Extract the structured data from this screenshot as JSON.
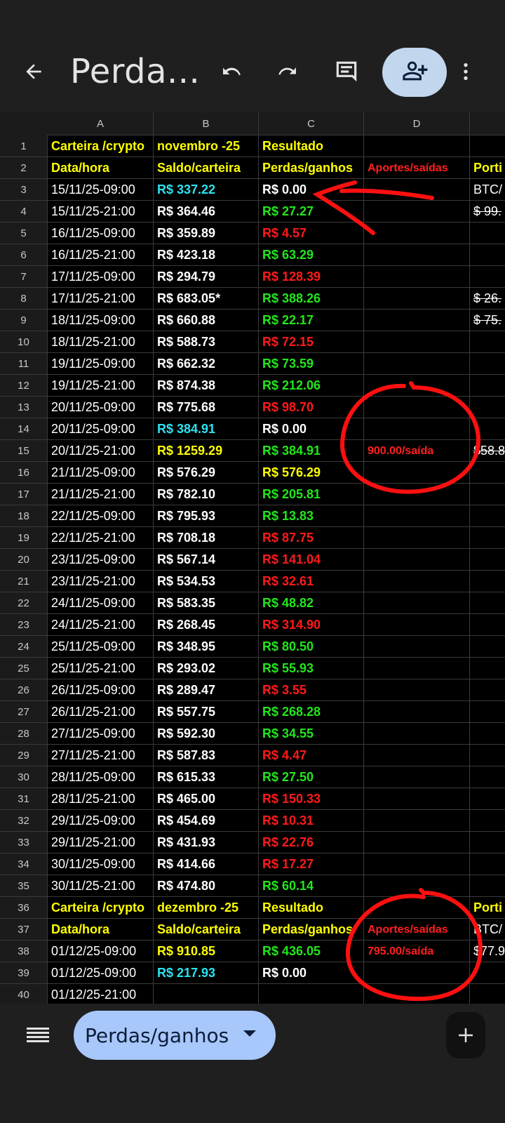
{
  "toolbar": {
    "title": "Perda...",
    "icons": [
      "back-arrow-icon",
      "undo-icon",
      "redo-icon",
      "comment-icon",
      "add-person-icon",
      "more-vert-icon"
    ]
  },
  "columns": [
    "A",
    "B",
    "C",
    "D"
  ],
  "rows": [
    {
      "n": "1",
      "a": "Carteira /crypto",
      "b": "  novembro -25",
      "c": "Resultado",
      "d": "",
      "e": "",
      "style": "header"
    },
    {
      "n": "2",
      "a": "Data/hora",
      "b": "Saldo/carteira",
      "c": "Perdas/ganhos",
      "d": "Aportes/saídas",
      "e": "Porti",
      "style": "header"
    },
    {
      "n": "3",
      "a": "15/11/25-09:00",
      "b": "R$ 337.22",
      "bc": "cyan",
      "c": "R$ 0.00",
      "cc": "white",
      "d": "",
      "e": "BTC/"
    },
    {
      "n": "4",
      "a": "15/11/25-21:00",
      "b": "R$ 364.46",
      "bc": "white",
      "c": "R$ 27.27",
      "cc": "green",
      "d": "",
      "e": "$ 99.",
      "es": "strike"
    },
    {
      "n": "5",
      "a": "16/11/25-09:00",
      "b": "R$ 359.89",
      "bc": "white",
      "c": "R$ 4.57",
      "cc": "red",
      "d": "",
      "e": ""
    },
    {
      "n": "6",
      "a": "16/11/25-21:00",
      "b": "R$ 423.18",
      "bc": "white",
      "c": "R$ 63.29",
      "cc": "green",
      "d": "",
      "e": ""
    },
    {
      "n": "7",
      "a": "17/11/25-09:00",
      "b": "R$ 294.79",
      "bc": "white",
      "c": "R$ 128.39",
      "cc": "red",
      "d": "",
      "e": ""
    },
    {
      "n": "8",
      "a": "17/11/25-21:00",
      "b": "R$ 683.05*",
      "bc": "white",
      "c": "R$ 388.26",
      "cc": "green",
      "d": "",
      "e": "$ 26.",
      "es": "strike"
    },
    {
      "n": "9",
      "a": "18/11/25-09:00",
      "b": "R$ 660.88",
      "bc": "white",
      "c": "R$ 22.17",
      "cc": "green",
      "d": "",
      "e": "$ 75.",
      "es": "strike"
    },
    {
      "n": "10",
      "a": "18/11/25-21:00",
      "b": "R$ 588.73",
      "bc": "white",
      "c": "R$ 72.15",
      "cc": "red",
      "d": "",
      "e": ""
    },
    {
      "n": "11",
      "a": "19/11/25-09:00",
      "b": "R$ 662.32",
      "bc": "white",
      "c": "R$ 73.59",
      "cc": "green",
      "d": "",
      "e": ""
    },
    {
      "n": "12",
      "a": "19/11/25-21:00",
      "b": "R$ 874.38",
      "bc": "white",
      "c": "R$ 212.06",
      "cc": "green",
      "d": "",
      "e": ""
    },
    {
      "n": "13",
      "a": "20/11/25-09:00",
      "b": "R$ 775.68",
      "bc": "white",
      "c": "R$ 98.70",
      "cc": "red",
      "d": "",
      "e": ""
    },
    {
      "n": "14",
      "a": "20/11/25-09:00",
      "b": "R$ 384.91",
      "bc": "cyan",
      "c": "R$ 0.00",
      "cc": "white",
      "d": "",
      "e": ""
    },
    {
      "n": "15",
      "a": "20/11/25-21:00",
      "b": "R$ 1259.29",
      "bc": "yellow",
      "c": "R$ 384.91",
      "cc": "green",
      "d": "900.00/saída",
      "e": "$58.8",
      "es": "strike"
    },
    {
      "n": "16",
      "a": "21/11/25-09:00",
      "b": "R$ 576.29",
      "bc": "white",
      "c": "R$ 576.29",
      "cc": "yellow",
      "d": "",
      "e": ""
    },
    {
      "n": "17",
      "a": "21/11/25-21:00",
      "b": "R$ 782.10",
      "bc": "white",
      "c": "R$ 205.81",
      "cc": "green",
      "d": "",
      "e": ""
    },
    {
      "n": "18",
      "a": "22/11/25-09:00",
      "b": "R$ 795.93",
      "bc": "white",
      "c": "R$ 13.83",
      "cc": "green",
      "d": "",
      "e": ""
    },
    {
      "n": "19",
      "a": "22/11/25-21:00",
      "b": "R$ 708.18",
      "bc": "white",
      "c": "R$ 87.75",
      "cc": "red",
      "d": "",
      "e": ""
    },
    {
      "n": "20",
      "a": "23/11/25-09:00",
      "b": "R$ 567.14",
      "bc": "white",
      "c": "R$ 141.04",
      "cc": "red",
      "d": "",
      "e": ""
    },
    {
      "n": "21",
      "a": "23/11/25-21:00",
      "b": "R$ 534.53",
      "bc": "white",
      "c": "R$ 32.61",
      "cc": "red",
      "d": "",
      "e": ""
    },
    {
      "n": "22",
      "a": "24/11/25-09:00",
      "b": "R$ 583.35",
      "bc": "white",
      "c": "R$ 48.82",
      "cc": "green",
      "d": "",
      "e": ""
    },
    {
      "n": "23",
      "a": "24/11/25-21:00",
      "b": "R$ 268.45",
      "bc": "white",
      "c": "R$ 314.90",
      "cc": "red",
      "d": "",
      "e": ""
    },
    {
      "n": "24",
      "a": "25/11/25-09:00",
      "b": "R$ 348.95",
      "bc": "white",
      "c": "R$ 80.50",
      "cc": "green",
      "d": "",
      "e": ""
    },
    {
      "n": "25",
      "a": "25/11/25-21:00",
      "b": "R$ 293.02",
      "bc": "white",
      "c": "R$ 55.93",
      "cc": "green",
      "d": "",
      "e": ""
    },
    {
      "n": "26",
      "a": "26/11/25-09:00",
      "b": "R$ 289.47",
      "bc": "white",
      "c": "R$ 3.55",
      "cc": "red",
      "d": "",
      "e": ""
    },
    {
      "n": "27",
      "a": "26/11/25-21:00",
      "b": "R$ 557.75",
      "bc": "white",
      "c": "R$ 268.28",
      "cc": "green",
      "d": "",
      "e": ""
    },
    {
      "n": "28",
      "a": "27/11/25-09:00",
      "b": "R$ 592.30",
      "bc": "white",
      "c": "R$ 34.55",
      "cc": "green",
      "d": "",
      "e": ""
    },
    {
      "n": "29",
      "a": "27/11/25-21:00",
      "b": "R$ 587.83",
      "bc": "white",
      "c": "R$ 4.47",
      "cc": "red",
      "d": "",
      "e": ""
    },
    {
      "n": "30",
      "a": "28/11/25-09:00",
      "b": "R$ 615.33",
      "bc": "white",
      "c": "R$ 27.50",
      "cc": "green",
      "d": "",
      "e": ""
    },
    {
      "n": "31",
      "a": "28/11/25-21:00",
      "b": "R$ 465.00",
      "bc": "white",
      "c": "R$ 150.33",
      "cc": "red",
      "d": "",
      "e": ""
    },
    {
      "n": "32",
      "a": "29/11/25-09:00",
      "b": "R$ 454.69",
      "bc": "white",
      "c": "R$ 10.31",
      "cc": "red",
      "d": "",
      "e": ""
    },
    {
      "n": "33",
      "a": "29/11/25-21:00",
      "b": "R$ 431.93",
      "bc": "white",
      "c": "R$ 22.76",
      "cc": "red",
      "d": "",
      "e": ""
    },
    {
      "n": "34",
      "a": "30/11/25-09:00",
      "b": "R$ 414.66",
      "bc": "white",
      "c": "R$ 17.27",
      "cc": "red",
      "d": "",
      "e": ""
    },
    {
      "n": "35",
      "a": "30/11/25-21:00",
      "b": "R$ 474.80",
      "bc": "white",
      "c": "R$ 60.14",
      "cc": "green",
      "d": "",
      "e": ""
    },
    {
      "n": "36",
      "a": "Carteira /crypto",
      "b": "  dezembro -25",
      "c": "Resultado",
      "d": "",
      "e": "Porti",
      "style": "header"
    },
    {
      "n": "37",
      "a": "Data/hora",
      "b": "Saldo/carteira",
      "c": "Perdas/ganhos",
      "d": "Aportes/saídas",
      "e": "BTC/",
      "style": "header",
      "ec": "white"
    },
    {
      "n": "38",
      "a": "01/12/25-09:00",
      "b": "R$ 910.85",
      "bc": "yellow",
      "c": "R$ 436.05",
      "cc": "green",
      "d": "795.00/saída",
      "e": "$77.9"
    },
    {
      "n": "39",
      "a": "01/12/25-09:00",
      "b": "R$ 217.93",
      "bc": "cyan",
      "c": "R$ 0.00",
      "cc": "white",
      "d": "",
      "e": ""
    },
    {
      "n": "40",
      "a": "01/12/25-21:00",
      "b": "",
      "c": "",
      "d": "",
      "e": ""
    }
  ],
  "bottombar": {
    "sheet_tab": "Perdas/ganhos",
    "icons": [
      "sheets-list-icon",
      "dropdown-arrow-icon",
      "add-sheet-icon"
    ]
  }
}
